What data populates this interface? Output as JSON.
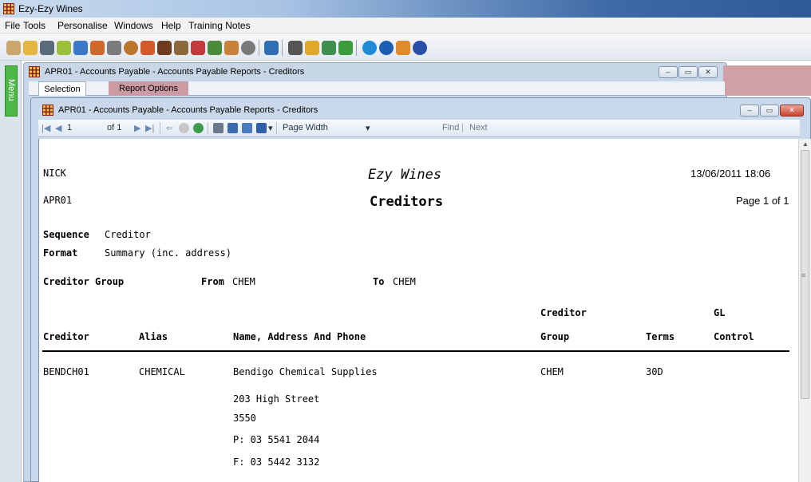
{
  "app": {
    "title": "Ezy-Ezy Wines"
  },
  "menu": [
    "File",
    "Tools",
    "Personalise",
    "Windows",
    "Help",
    "Training Notes"
  ],
  "side": {
    "menu_label": "Menu"
  },
  "outer_window": {
    "title": "APR01 - Accounts Payable - Accounts Payable Reports -  Creditors",
    "tabs": [
      "Selection",
      "Report Options"
    ]
  },
  "inner_window": {
    "title": "APR01 - Accounts Payable - Accounts Payable Reports -  Creditors"
  },
  "report_toolbar": {
    "page_current": "1",
    "page_of": "of 1",
    "zoom": "Page Width",
    "find": "Find",
    "next": "Next"
  },
  "report": {
    "user": "NICK",
    "code": "APR01",
    "company": "Ezy Wines",
    "title": "Creditors",
    "datetime": "13/06/2011 18:06",
    "page": "Page 1 of 1",
    "sequence_label": "Sequence",
    "sequence_value": "Creditor",
    "format_label": "Format",
    "format_value": "Summary (inc. address)",
    "group_label": "Creditor Group",
    "from_label": "From",
    "from_value": "CHEM",
    "to_label": "To",
    "to_value": "CHEM",
    "columns": {
      "creditor": "Creditor",
      "alias": "Alias",
      "name": "Name, Address And Phone",
      "group_top": "Creditor",
      "group": "Group",
      "terms": "Terms",
      "gl_top": "GL",
      "gl": "Control"
    },
    "row": {
      "creditor": "BENDCH01",
      "alias": "CHEMICAL",
      "name": "Bendigo Chemical Supplies",
      "group": "CHEM",
      "terms": "30D",
      "address": [
        "203 High Street",
        "3550",
        "P: 03 5541 2044",
        "F: 03 5442 3132"
      ]
    }
  }
}
